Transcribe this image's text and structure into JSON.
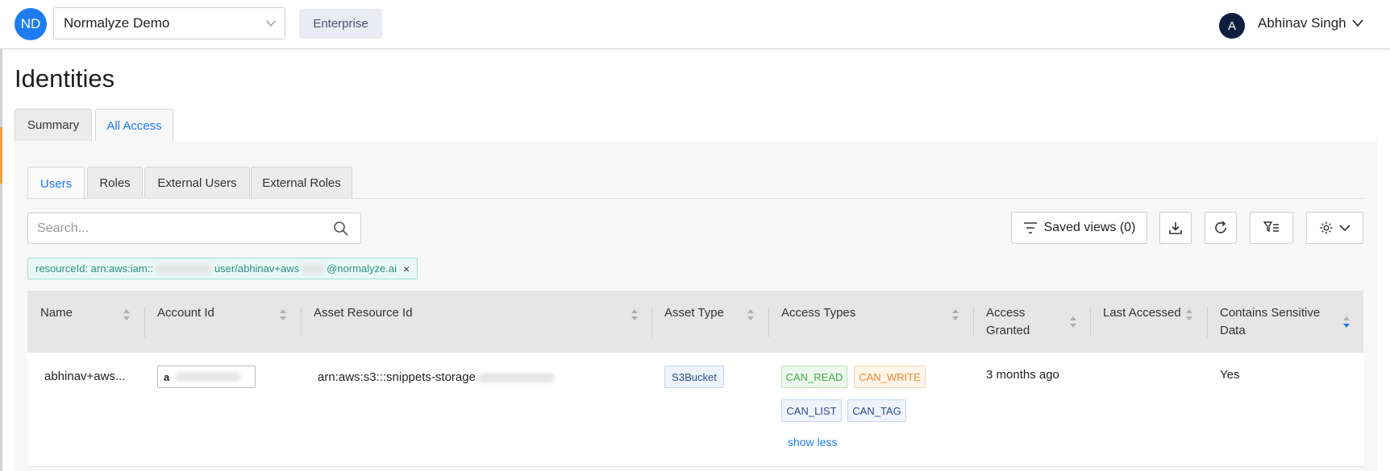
{
  "header": {
    "org_initials": "ND",
    "org_name": "Normalyze Demo",
    "plan_badge": "Enterprise",
    "user_initial": "A",
    "user_name": "Abhinav Singh"
  },
  "page": {
    "title": "Identities",
    "main_tabs": [
      {
        "label": "Summary",
        "active": false
      },
      {
        "label": "All Access",
        "active": true
      }
    ],
    "sub_tabs": [
      {
        "label": "Users",
        "active": true
      },
      {
        "label": "Roles",
        "active": false
      },
      {
        "label": "External Users",
        "active": false
      },
      {
        "label": "External Roles",
        "active": false
      }
    ]
  },
  "toolbar": {
    "search_placeholder": "Search...",
    "saved_views_label": "Saved views (0)"
  },
  "filter": {
    "label": "resourceId: arn:aws:iam::",
    "label_tail_1": "user/abhinav+aws",
    "label_tail_2": "@normalyze.ai",
    "remove": "×"
  },
  "table": {
    "columns": [
      {
        "label": "Name"
      },
      {
        "label": "Account Id"
      },
      {
        "label": "Asset Resource Id"
      },
      {
        "label": "Asset Type"
      },
      {
        "label": "Access Types"
      },
      {
        "label": "Access\nGranted"
      },
      {
        "label": "Last Accessed"
      },
      {
        "label": "Contains Sensitive\nData"
      }
    ],
    "rows": [
      {
        "name": "abhinav+aws...",
        "account_id": "",
        "asset_resource_id": "arn:aws:s3:::snippets-storage",
        "asset_type": "S3Bucket",
        "access_types": [
          "CAN_READ",
          "CAN_WRITE",
          "CAN_LIST",
          "CAN_TAG"
        ],
        "access_granted": "3 months ago",
        "last_accessed": "",
        "contains_sensitive_data": "Yes",
        "toggle_label": "show less"
      }
    ]
  },
  "colors": {
    "brand_blue": "#1d7cf2",
    "read": "#45a845",
    "write": "#e88a2c",
    "filter_teal": "#2b8f82"
  }
}
